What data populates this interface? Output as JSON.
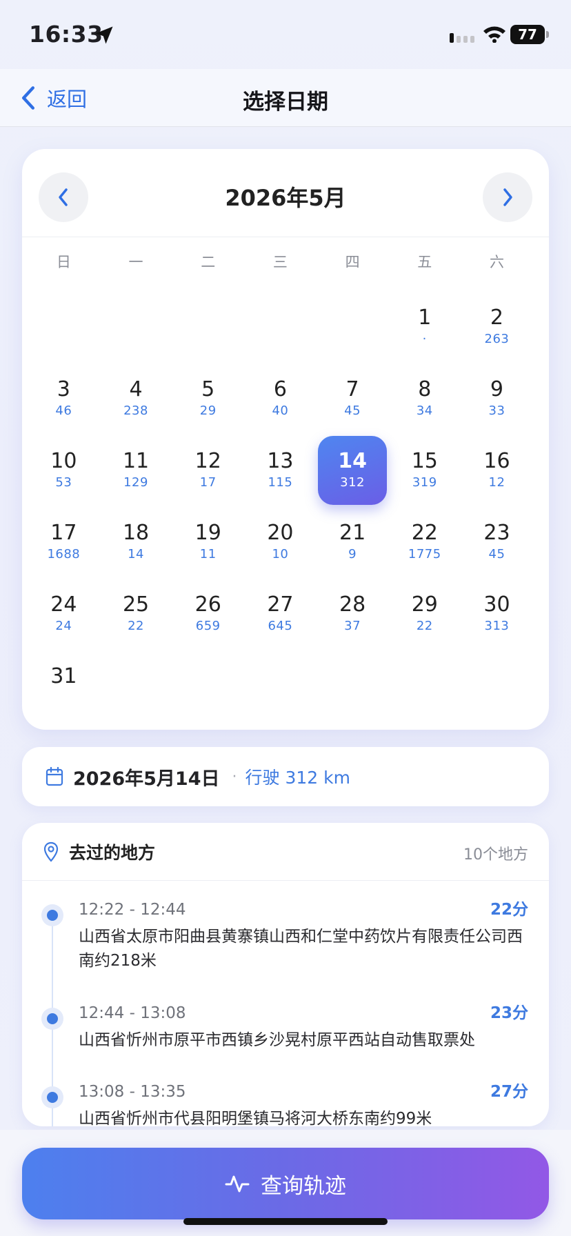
{
  "status_bar": {
    "time": "16:33",
    "battery": "77"
  },
  "nav": {
    "back_label": "返回",
    "title": "选择日期"
  },
  "calendar": {
    "month_title": "2026年5月",
    "weekdays": [
      "日",
      "一",
      "二",
      "三",
      "四",
      "五",
      "六"
    ],
    "leading_blanks": 5,
    "selected_day": "14",
    "days": [
      {
        "day": "1",
        "km": "·"
      },
      {
        "day": "2",
        "km": "263"
      },
      {
        "day": "3",
        "km": "46"
      },
      {
        "day": "4",
        "km": "238"
      },
      {
        "day": "5",
        "km": "29"
      },
      {
        "day": "6",
        "km": "40"
      },
      {
        "day": "7",
        "km": "45"
      },
      {
        "day": "8",
        "km": "34"
      },
      {
        "day": "9",
        "km": "33"
      },
      {
        "day": "10",
        "km": "53"
      },
      {
        "day": "11",
        "km": "129"
      },
      {
        "day": "12",
        "km": "17"
      },
      {
        "day": "13",
        "km": "115"
      },
      {
        "day": "14",
        "km": "312"
      },
      {
        "day": "15",
        "km": "319"
      },
      {
        "day": "16",
        "km": "12"
      },
      {
        "day": "17",
        "km": "1688"
      },
      {
        "day": "18",
        "km": "14"
      },
      {
        "day": "19",
        "km": "11"
      },
      {
        "day": "20",
        "km": "10"
      },
      {
        "day": "21",
        "km": "9"
      },
      {
        "day": "22",
        "km": "1775"
      },
      {
        "day": "23",
        "km": "45"
      },
      {
        "day": "24",
        "km": "24"
      },
      {
        "day": "25",
        "km": "22"
      },
      {
        "day": "26",
        "km": "659"
      },
      {
        "day": "27",
        "km": "645"
      },
      {
        "day": "28",
        "km": "37"
      },
      {
        "day": "29",
        "km": "22"
      },
      {
        "day": "30",
        "km": "313"
      },
      {
        "day": "31",
        "km": ""
      }
    ]
  },
  "summary": {
    "date": "2026年5月14日",
    "separator": "·",
    "distance": "行驶 312 km"
  },
  "places": {
    "title": "去过的地方",
    "count": "10个地方",
    "items": [
      {
        "time": "12:22 - 12:44",
        "duration": "22分",
        "address": "山西省太原市阳曲县黄寨镇山西和仁堂中药饮片有限责任公司西南约218米"
      },
      {
        "time": "12:44 - 13:08",
        "duration": "23分",
        "address": "山西省忻州市原平市西镇乡沙晃村原平西站自动售取票处"
      },
      {
        "time": "13:08 - 13:35",
        "duration": "27分",
        "address": "山西省忻州市代县阳明堡镇马将河大桥东南约99米"
      }
    ]
  },
  "query_button": {
    "label": "查询轨迹"
  },
  "colors": {
    "accent": "#3e7ae0",
    "gradient_start": "#4d80ee",
    "gradient_end": "#9258e6"
  }
}
